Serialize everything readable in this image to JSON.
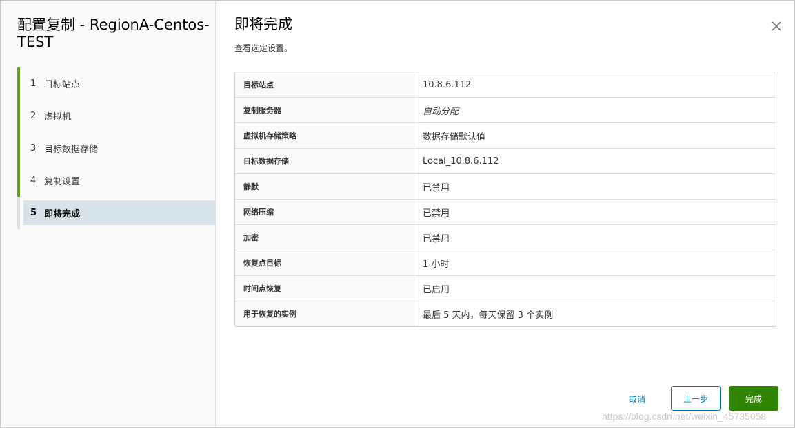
{
  "sidebar": {
    "title": "配置复制 - RegionA-Centos-TEST",
    "steps": [
      {
        "num": "1",
        "label": "目标站点"
      },
      {
        "num": "2",
        "label": "虚拟机"
      },
      {
        "num": "3",
        "label": "目标数据存储"
      },
      {
        "num": "4",
        "label": "复制设置"
      },
      {
        "num": "5",
        "label": "即将完成"
      }
    ]
  },
  "main": {
    "title": "即将完成",
    "subtitle": "查看选定设置。",
    "summary": [
      {
        "key": "目标站点",
        "value": "10.8.6.112"
      },
      {
        "key": "复制服务器",
        "value": "自动分配"
      },
      {
        "key": "虚拟机存储策略",
        "value": "数据存储默认值"
      },
      {
        "key": "目标数据存储",
        "value": "Local_10.8.6.112"
      },
      {
        "key": "静默",
        "value": "已禁用"
      },
      {
        "key": "网络压缩",
        "value": "已禁用"
      },
      {
        "key": "加密",
        "value": "已禁用"
      },
      {
        "key": "恢复点目标",
        "value": "1 小时"
      },
      {
        "key": "时间点恢复",
        "value": "已启用"
      },
      {
        "key": "用于恢复的实例",
        "value": "最后 5 天内，每天保留 3 个实例"
      }
    ]
  },
  "footer": {
    "cancel_label": "取消",
    "back_label": "上一步",
    "finish_label": "完成"
  },
  "watermark": "https://blog.csdn.net/weixin_45735058",
  "colors": {
    "accent": "#0079b8",
    "finish": "#2f8400",
    "step_done": "#62a420",
    "active_step_bg": "#d8e3e9"
  },
  "icons": {
    "close": "close-icon"
  }
}
